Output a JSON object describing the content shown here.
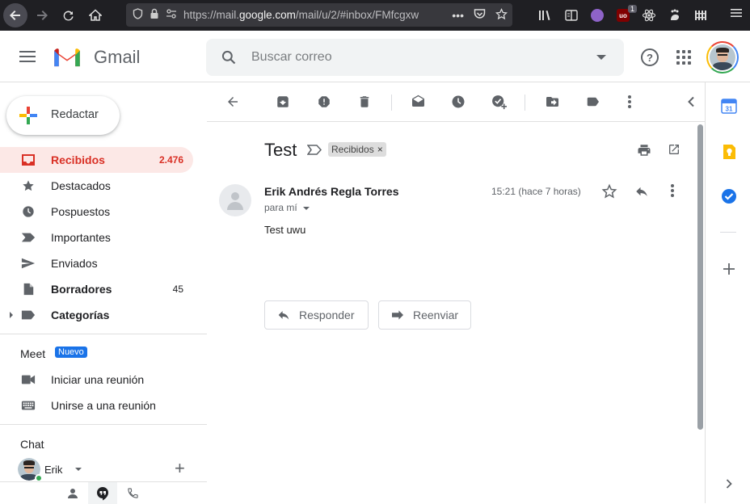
{
  "browser": {
    "url_prefix": "https://mail.",
    "url_domain": "google.com",
    "url_rest": "/mail/u/2/#inbox/FMfcgxw",
    "ublock_badge": "1"
  },
  "header": {
    "app_name": "Gmail",
    "search_placeholder": "Buscar correo"
  },
  "sidebar": {
    "compose_label": "Redactar",
    "items": [
      {
        "label": "Recibidos",
        "count": "2.476",
        "icon": "inbox-icon"
      },
      {
        "label": "Destacados",
        "count": "",
        "icon": "star-icon"
      },
      {
        "label": "Pospuestos",
        "count": "",
        "icon": "clock-icon"
      },
      {
        "label": "Importantes",
        "count": "",
        "icon": "important-icon"
      },
      {
        "label": "Enviados",
        "count": "",
        "icon": "send-icon"
      },
      {
        "label": "Borradores",
        "count": "45",
        "icon": "draft-icon"
      },
      {
        "label": "Categorías",
        "count": "",
        "icon": "label-icon"
      }
    ],
    "meet": {
      "title": "Meet",
      "badge": "Nuevo",
      "start": "Iniciar una reunión",
      "join": "Unirse a una reunión"
    },
    "chat": {
      "title": "Chat",
      "user": "Erik"
    }
  },
  "email": {
    "subject": "Test",
    "label": "Recibidos",
    "sender": "Erik Andrés Regla Torres",
    "to": "para mí",
    "time": "15:21 (hace 7 horas)",
    "body": "Test uwu",
    "reply_label": "Responder",
    "forward_label": "Reenviar"
  },
  "right_panel": {
    "calendar_day": "31"
  },
  "colors": {
    "accent_red": "#d93025",
    "active_bg": "#fce8e6",
    "blue": "#1a73e8"
  }
}
